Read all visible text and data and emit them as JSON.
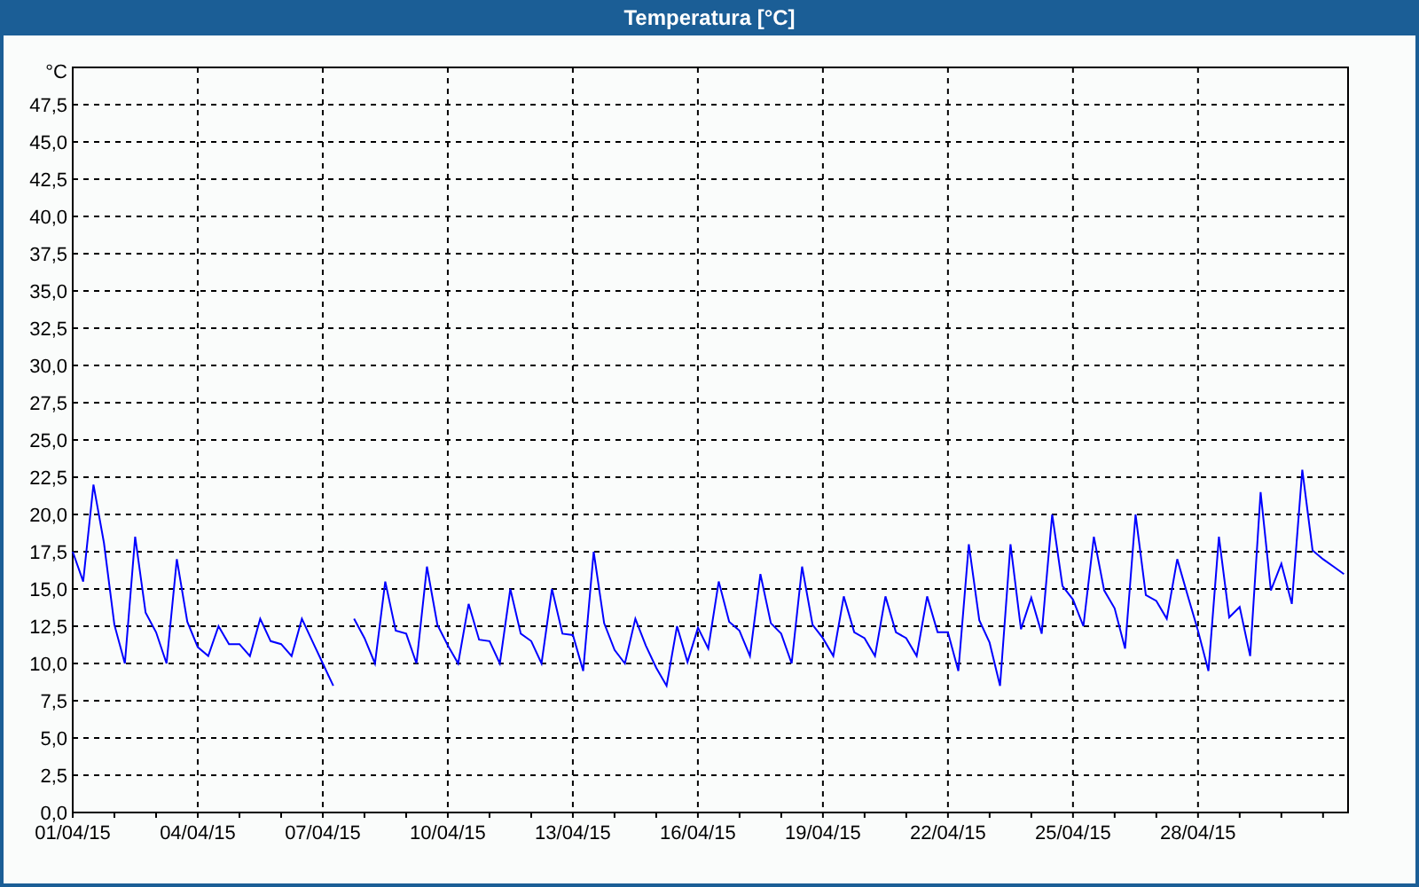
{
  "window": {
    "title": "Temperatura [°C]"
  },
  "chart": {
    "chart_data": {
      "type": "line",
      "grid": true,
      "ylabel": "°C",
      "ylim": [
        0,
        50
      ],
      "yticks": [
        {
          "value": 0,
          "label": "0,0"
        },
        {
          "value": 2.5,
          "label": "2,5"
        },
        {
          "value": 5,
          "label": "5,0"
        },
        {
          "value": 7.5,
          "label": "7,5"
        },
        {
          "value": 10,
          "label": "10,0"
        },
        {
          "value": 12.5,
          "label": "12,5"
        },
        {
          "value": 15,
          "label": "15,0"
        },
        {
          "value": 17.5,
          "label": "17,5"
        },
        {
          "value": 20,
          "label": "20,0"
        },
        {
          "value": 22.5,
          "label": "22,5"
        },
        {
          "value": 25,
          "label": "25,0"
        },
        {
          "value": 27.5,
          "label": "27,5"
        },
        {
          "value": 30,
          "label": "30,0"
        },
        {
          "value": 32.5,
          "label": "32,5"
        },
        {
          "value": 35,
          "label": "35,0"
        },
        {
          "value": 37.5,
          "label": "37,5"
        },
        {
          "value": 40,
          "label": "40,0"
        },
        {
          "value": 42.5,
          "label": "42,5"
        },
        {
          "value": 45,
          "label": "45,0"
        },
        {
          "value": 47.5,
          "label": "47,5"
        }
      ],
      "categories": [
        "01/04/15",
        null,
        null,
        null,
        null,
        null,
        null,
        null,
        null,
        null,
        null,
        null,
        "04/04/15",
        null,
        null,
        null,
        null,
        null,
        null,
        null,
        null,
        null,
        null,
        null,
        "07/04/15",
        null,
        null,
        null,
        null,
        null,
        null,
        null,
        null,
        null,
        null,
        null,
        "10/04/15",
        null,
        null,
        null,
        null,
        null,
        null,
        null,
        null,
        null,
        null,
        null,
        "13/04/15",
        null,
        null,
        null,
        null,
        null,
        null,
        null,
        null,
        null,
        null,
        null,
        "16/04/15",
        null,
        null,
        null,
        null,
        null,
        null,
        null,
        null,
        null,
        null,
        null,
        "19/04/15",
        null,
        null,
        null,
        null,
        null,
        null,
        null,
        null,
        null,
        null,
        null,
        "22/04/15",
        null,
        null,
        null,
        null,
        null,
        null,
        null,
        null,
        null,
        null,
        null,
        "25/04/15",
        null,
        null,
        null,
        null,
        null,
        null,
        null,
        null,
        null,
        null,
        null,
        "28/04/15",
        null,
        null,
        null,
        null,
        null,
        null,
        null,
        null,
        null,
        null,
        null,
        null,
        null,
        null
      ],
      "series": [
        {
          "color": "#0000ff",
          "values": [
            17.5,
            15.5,
            22.0,
            18.1,
            12.6,
            10.0,
            18.5,
            13.4,
            12.1,
            10.0,
            17.0,
            12.8,
            11.1,
            10.5,
            12.5,
            11.3,
            11.3,
            10.5,
            13.0,
            11.5,
            11.3,
            10.5,
            13.0,
            11.5,
            10.0,
            8.5,
            null,
            13.0,
            11.7,
            10.0,
            15.5,
            12.2,
            12.0,
            10.0,
            16.5,
            12.6,
            11.2,
            10.0,
            14.0,
            11.6,
            11.5,
            10.0,
            15.0,
            12.0,
            11.5,
            10.0,
            15.0,
            12.0,
            11.9,
            9.5,
            17.5,
            12.7,
            10.9,
            10.0,
            13.0,
            11.2,
            9.7,
            8.5,
            12.5,
            10.1,
            12.4,
            11.0,
            15.5,
            12.8,
            12.2,
            10.5,
            16.0,
            12.7,
            12.0,
            10.0,
            16.5,
            12.6,
            11.7,
            10.5,
            14.5,
            12.1,
            11.7,
            10.5,
            14.5,
            12.1,
            11.7,
            10.5,
            14.5,
            12.1,
            12.1,
            9.5,
            18.0,
            12.9,
            11.4,
            8.5,
            18.0,
            12.3,
            14.4,
            12.0,
            20.0,
            15.2,
            14.3,
            12.5,
            18.5,
            14.9,
            13.7,
            11.0,
            20.0,
            14.6,
            14.2,
            13.0,
            17.0,
            14.6,
            12.2,
            9.5,
            18.5,
            13.1,
            13.8,
            10.5,
            21.5,
            14.9,
            16.7,
            14.0,
            23.0,
            17.6,
            17.0,
            16.5,
            16.0
          ]
        }
      ]
    }
  }
}
